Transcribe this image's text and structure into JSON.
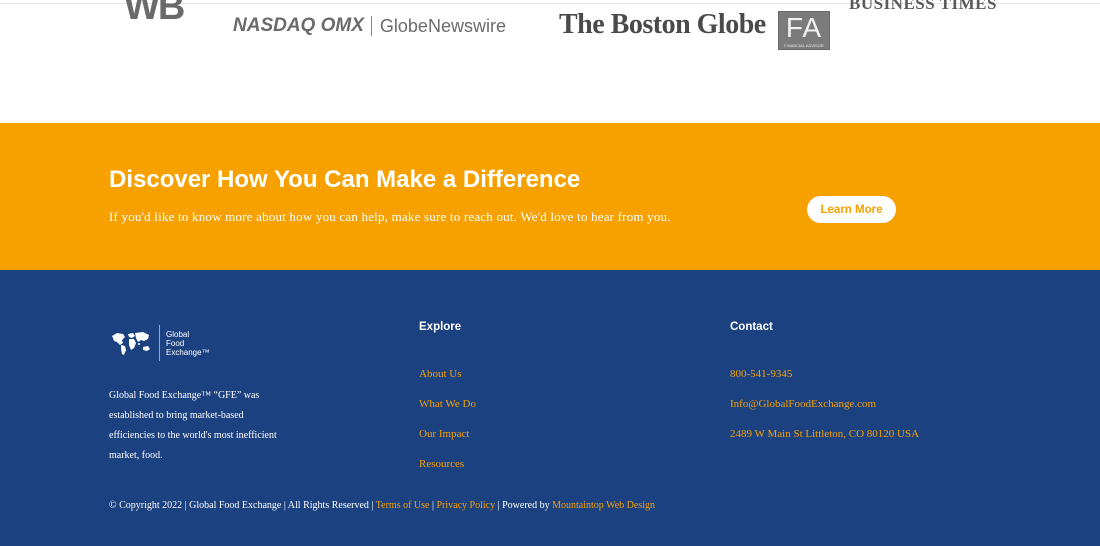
{
  "logos": {
    "wb": "WB",
    "nasdaq": "NASDAQ OMX",
    "globenewswire": "GlobeNewswire",
    "boston_globe": "The Boston Globe",
    "fa": "FA",
    "fa_small": "FINANCIAL ADVISOR",
    "business_times": "BUSINESS TIMES"
  },
  "cta": {
    "title": "Discover How You Can Make a Difference",
    "text": "If you'd like to know more about how you can help, make sure to reach out. We'd love to hear from you.",
    "button_label": "Learn More",
    "bg_color": "#f6a100"
  },
  "footer": {
    "bg_color": "#1c4180",
    "brand": {
      "line1": "Global",
      "line2": "Food",
      "line3": "Exchange™"
    },
    "about": "Global Food Exchange™ “GFE” was established to bring market-based efficiencies to the world's most inefficient market, food.",
    "explore": {
      "heading": "Explore",
      "items": [
        {
          "label": "About Us"
        },
        {
          "label": "What We Do"
        },
        {
          "label": "Our Impact"
        },
        {
          "label": "Resources"
        }
      ]
    },
    "contact": {
      "heading": "Contact",
      "phone": "800-541-9345",
      "email": "Info@GlobalFoodExchange.com",
      "address": "2489 W Main St Littleton, CO 80120 USA"
    },
    "copyright": {
      "prefix": "© Copyright 2022 | Global Food Exchange | All Rights Reserved | ",
      "terms": "Terms of Use",
      "sep1": " | ",
      "privacy": "Privacy Policy",
      "sep2": " | Powered by ",
      "powered": "Mountaintop Web Design"
    }
  }
}
